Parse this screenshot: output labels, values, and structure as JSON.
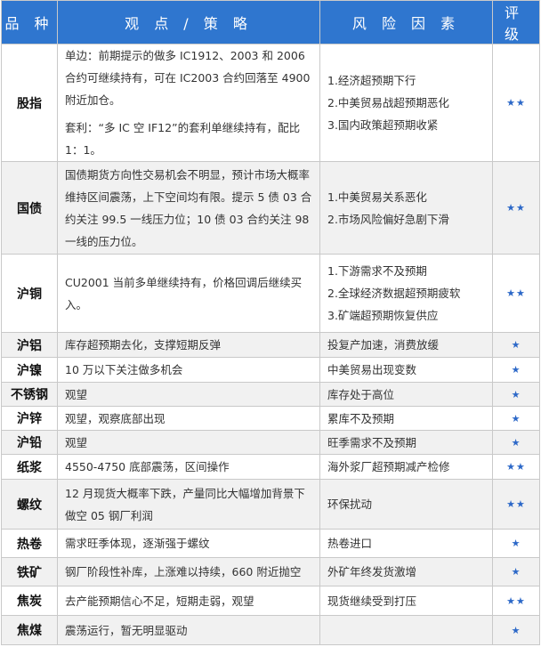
{
  "header": {
    "variety": "品 种",
    "strategy": "观 点 / 策 略",
    "risk": "风 险 因 素",
    "rating": "评 级"
  },
  "rows": [
    {
      "variety": "股指",
      "strategy": [
        "单边：前期提示的做多 IC1912、2003 和 2006 合约可继续持有，可在 IC2003 合约回落至 4900 附近加仓。",
        "套利：“多 IC 空 IF12”的套利单继续持有，配比 1：1。"
      ],
      "risks": [
        "1.经济超预期下行",
        "2.中美贸易战超预期恶化",
        "3.国内政策超预期收紧"
      ],
      "rating": "★★"
    },
    {
      "variety": "国债",
      "strategy": [
        "国债期货方向性交易机会不明显，预计市场大概率维持区间震荡，上下空间均有限。提示 5 债 03 合约关注 99.5 一线压力位；10 债 03 合约关注 98 一线的压力位。"
      ],
      "risks": [
        "1.中美贸易关系恶化",
        "2.市场风险偏好急剧下滑"
      ],
      "rating": "★★"
    },
    {
      "variety": "沪铜",
      "strategy": [
        "CU2001 当前多单继续持有，价格回调后继续买入。"
      ],
      "risks": [
        "1.下游需求不及预期",
        "2.全球经济数据超预期疲软",
        "3.矿端超预期恢复供应"
      ],
      "rating": "★★"
    },
    {
      "variety": "沪铝",
      "strategy": [
        "库存超预期去化，支撑短期反弹"
      ],
      "risks": [
        "投复产加速，消费放缓"
      ],
      "rating": "★"
    },
    {
      "variety": "沪镍",
      "strategy": [
        "10 万以下关注做多机会"
      ],
      "risks": [
        "中美贸易出现变数"
      ],
      "rating": "★"
    },
    {
      "variety": "不锈钢",
      "strategy": [
        "观望"
      ],
      "risks": [
        "库存处于高位"
      ],
      "rating": "★"
    },
    {
      "variety": "沪锌",
      "strategy": [
        "观望，观察底部出现"
      ],
      "risks": [
        "累库不及预期"
      ],
      "rating": "★"
    },
    {
      "variety": "沪铅",
      "strategy": [
        "观望"
      ],
      "risks": [
        "旺季需求不及预期"
      ],
      "rating": "★"
    },
    {
      "variety": "纸浆",
      "strategy": [
        "4550-4750 底部震荡，区间操作"
      ],
      "risks": [
        "海外浆厂超预期减产检修"
      ],
      "rating": "★★"
    },
    {
      "variety": "螺纹",
      "strategy": [
        "12 月现货大概率下跌，产量同比大幅增加背景下做空 05 钢厂利润"
      ],
      "risks": [
        "环保扰动"
      ],
      "rating": "★★"
    },
    {
      "variety": "热卷",
      "strategy": [
        "需求旺季体现，逐渐强于螺纹"
      ],
      "risks": [
        "热卷进口"
      ],
      "rating": "★"
    },
    {
      "variety": "铁矿",
      "strategy": [
        "钢厂阶段性补库，上涨难以持续，660 附近抛空"
      ],
      "risks": [
        "外矿年终发货激增"
      ],
      "rating": "★"
    },
    {
      "variety": "焦炭",
      "strategy": [
        "去产能预期信心不足，短期走弱，观望"
      ],
      "risks": [
        "现货继续受到打压"
      ],
      "rating": "★★"
    },
    {
      "variety": "焦煤",
      "strategy": [
        "震荡运行，暂无明显驱动"
      ],
      "risks": [
        ""
      ],
      "rating": "★"
    }
  ],
  "colors": {
    "header_bg": "#2f76cf",
    "header_text": "#ffffff",
    "star": "#2c68c8",
    "alt_row_bg": "#f1f1f1",
    "border": "#c9c9c9"
  }
}
